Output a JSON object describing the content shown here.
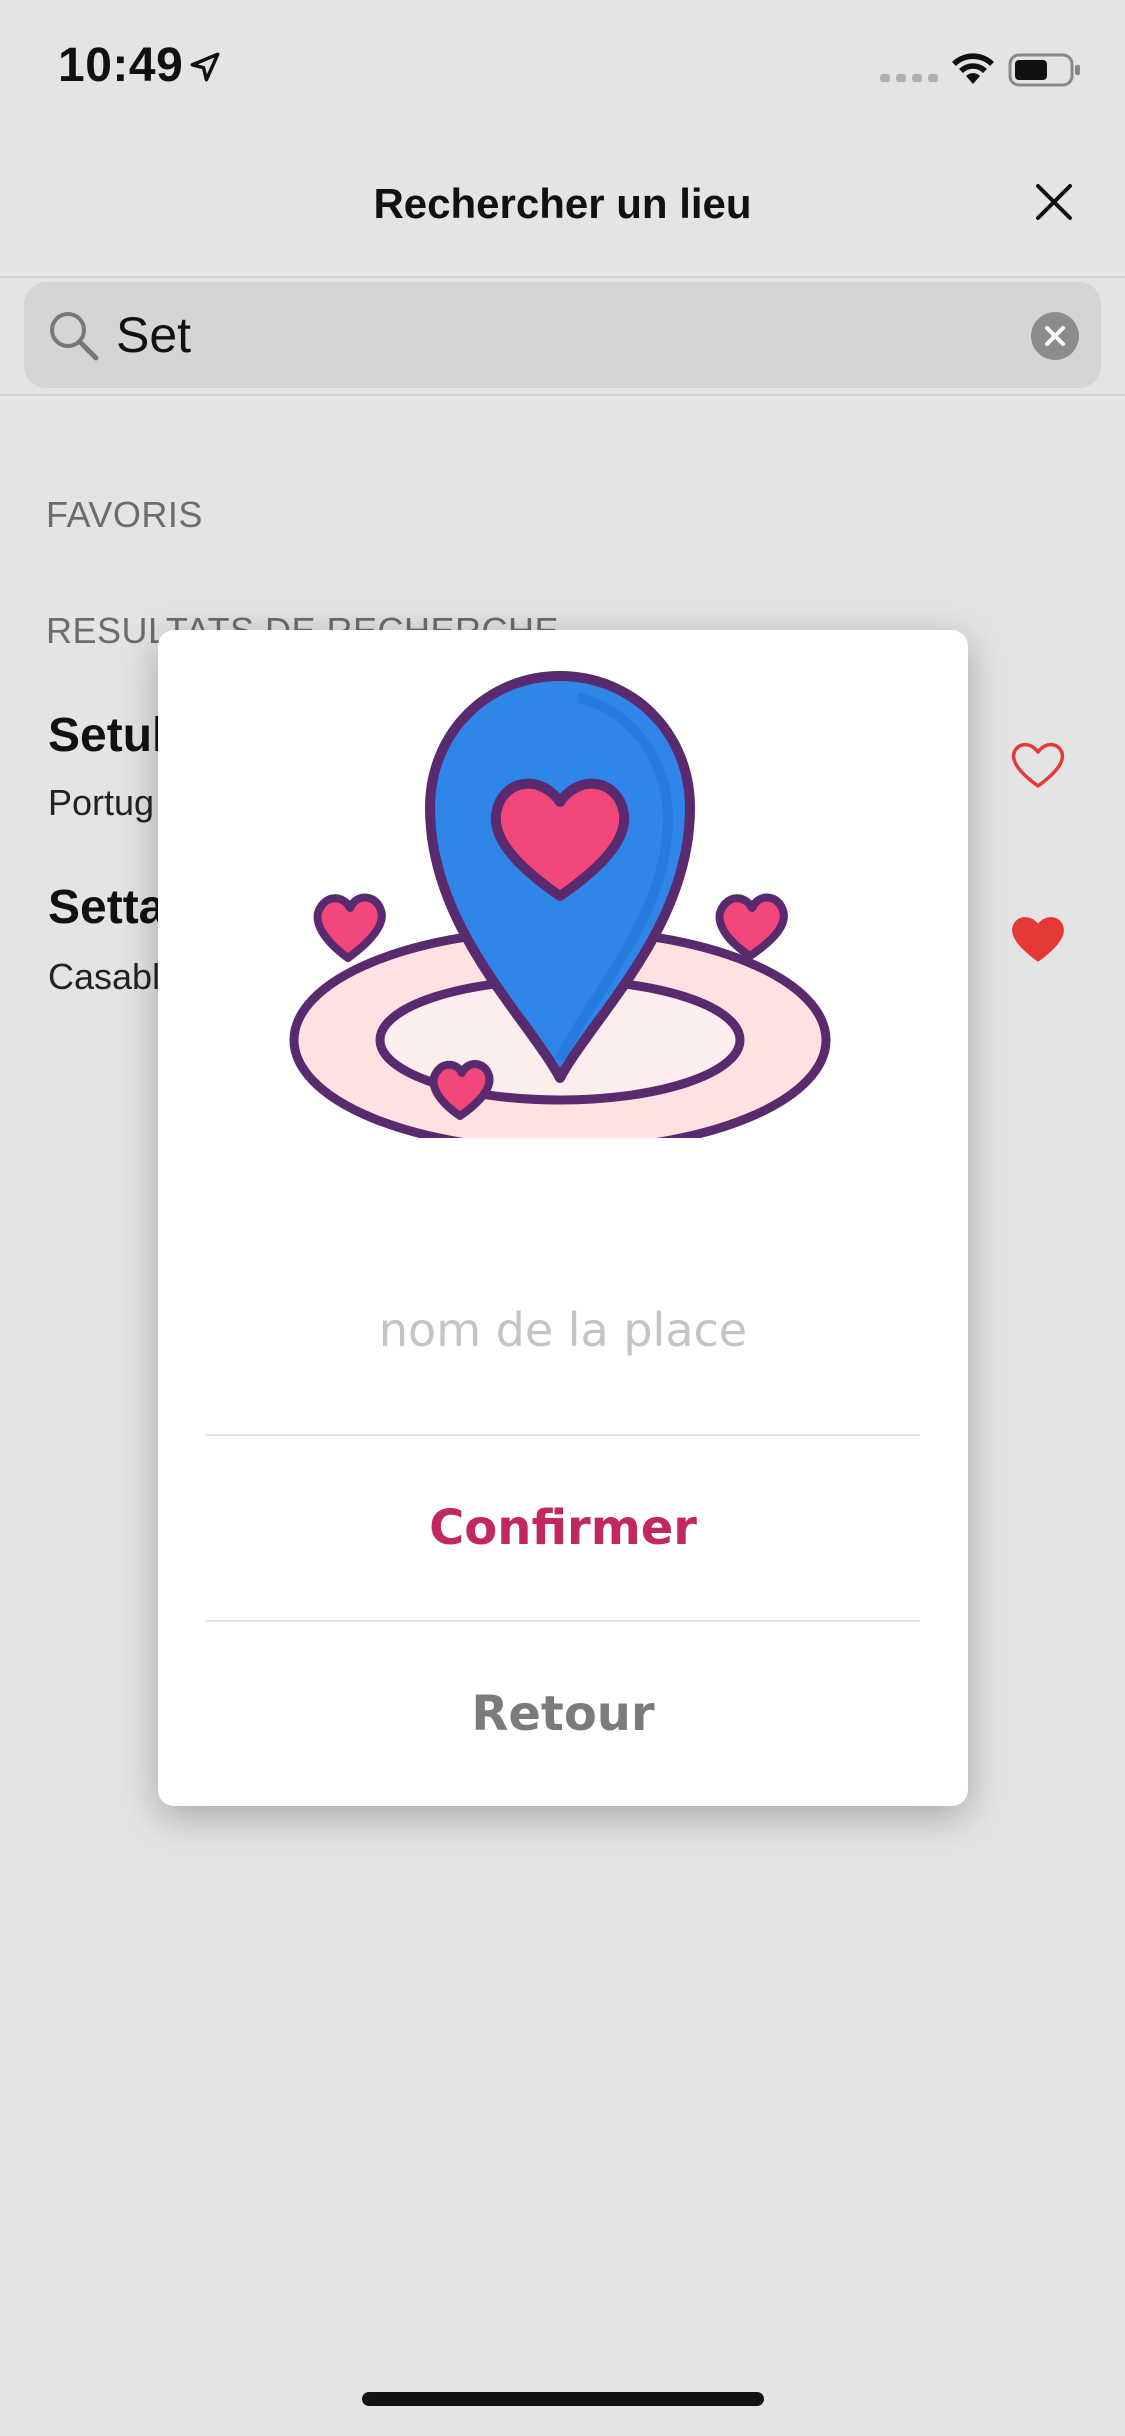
{
  "status_bar": {
    "time": "10:49"
  },
  "header": {
    "title": "Rechercher un lieu"
  },
  "search": {
    "value": "Set"
  },
  "sections": {
    "favorites": "FAVORIS",
    "results": "RESULTATS DE RECHERCHE"
  },
  "results": [
    {
      "title": "Setul",
      "subtitle": "Portug",
      "favorite": false
    },
    {
      "title": "Setta",
      "subtitle": "Casabl",
      "favorite": true
    }
  ],
  "modal": {
    "input_placeholder": "nom de la place",
    "confirm_label": "Confirmer",
    "back_label": "Retour"
  },
  "colors": {
    "accent": "#c3275f",
    "heart_red": "#e53935",
    "pin_blue": "#2f86e8",
    "pin_outline": "#5a2a6e",
    "heart_pink": "#f2477a"
  }
}
